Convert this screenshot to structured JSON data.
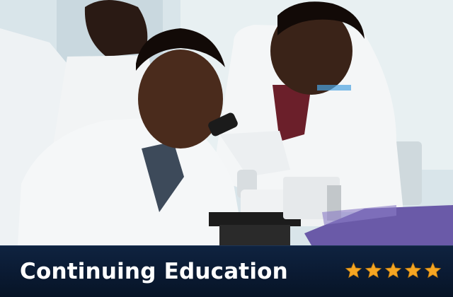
{
  "banner": {
    "title": "Continuing Education",
    "rating": {
      "value": 5,
      "max": 5
    },
    "colors": {
      "bar_background": "#0a1a32",
      "title_text": "#ffffff",
      "star_fill": "#f5a623"
    },
    "photo": {
      "alt": "students at microscope"
    }
  }
}
